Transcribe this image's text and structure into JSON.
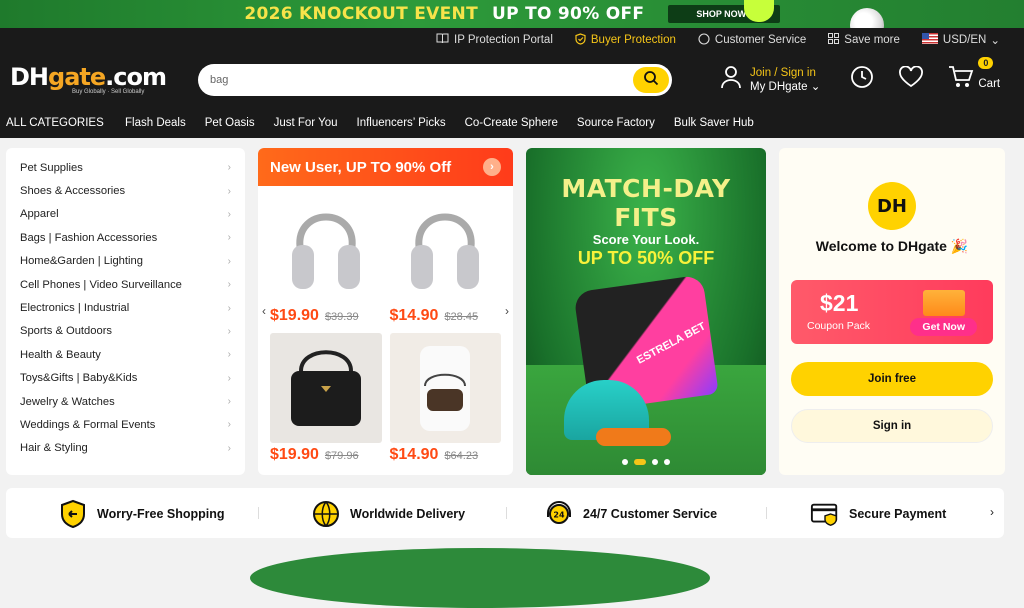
{
  "promo": {
    "title_part1": "2026 KNOCKOUT EVENT",
    "title_part2": "UP TO 90% OFF",
    "shop_now": "SHOP NOW ›"
  },
  "topbar": {
    "ip_protection": "IP Protection Portal",
    "buyer_protection": "Buyer Protection",
    "customer_service": "Customer Service",
    "save_more": "Save more",
    "locale": "USD/EN"
  },
  "header": {
    "logo_text_dh": "DH",
    "logo_text_g": "gate",
    "logo_text_com": ".com",
    "logo_tagline": "Buy Globally · Sell Globally",
    "search_value": "bag",
    "join_signin": "Join / Sign in",
    "my_dhgate": "My DHgate",
    "cart_count": "0",
    "cart_label": "Cart"
  },
  "nav": {
    "all_categories": "ALL CATEGORIES",
    "items": [
      "Flash Deals",
      "Pet Oasis",
      "Just For You",
      "Influencers’ Picks",
      "Co-Create Sphere",
      "Source Factory",
      "Bulk Saver Hub"
    ]
  },
  "categories": [
    "Pet Supplies",
    "Shoes & Accessories",
    "Apparel",
    "Bags  |  Fashion Accessories",
    "Home&Garden  |  Lighting",
    "Cell Phones  |  Video Surveillance",
    "Electronics  |  Industrial",
    "Sports & Outdoors",
    "Health & Beauty",
    "Toys&Gifts  |  Baby&Kids",
    "Jewelry & Watches",
    "Weddings & Formal Events",
    "Hair & Styling"
  ],
  "new_user": {
    "title": "New User,  UP TO 90% Off",
    "products": [
      {
        "price": "$19.90",
        "old": "$39.39",
        "kind": "headphones"
      },
      {
        "price": "$14.90",
        "old": "$28.45",
        "kind": "headphones"
      },
      {
        "price": "$19.90",
        "old": "$79.96",
        "kind": "black-bag"
      },
      {
        "price": "$14.90",
        "old": "$64.23",
        "kind": "small-bag"
      }
    ]
  },
  "banner": {
    "line1": "MATCH-DAY",
    "line2": "FITS",
    "subtitle": "Score Your Look.",
    "offer": "UP TO 50% OFF",
    "jersey_text": "ESTRELA BET"
  },
  "welcome": {
    "logo": "DH",
    "title": "Welcome to DHgate 🎉",
    "coupon_amount": "$21",
    "coupon_label": "Coupon Pack",
    "coupon_get": "Get Now",
    "join_free": "Join free",
    "sign_in": "Sign in"
  },
  "features": [
    {
      "label": "Worry-Free Shopping",
      "icon": "shield-icon"
    },
    {
      "label": "Worldwide Delivery",
      "icon": "globe-icon"
    },
    {
      "label": "24/7 Customer Service",
      "icon": "headset-icon"
    },
    {
      "label": "Secure Payment",
      "icon": "card-icon"
    }
  ],
  "colors": {
    "accent": "#ffd200",
    "dark": "#1a1a1a",
    "price": "#ff4a14",
    "promo_green": "#2d9a3a"
  }
}
